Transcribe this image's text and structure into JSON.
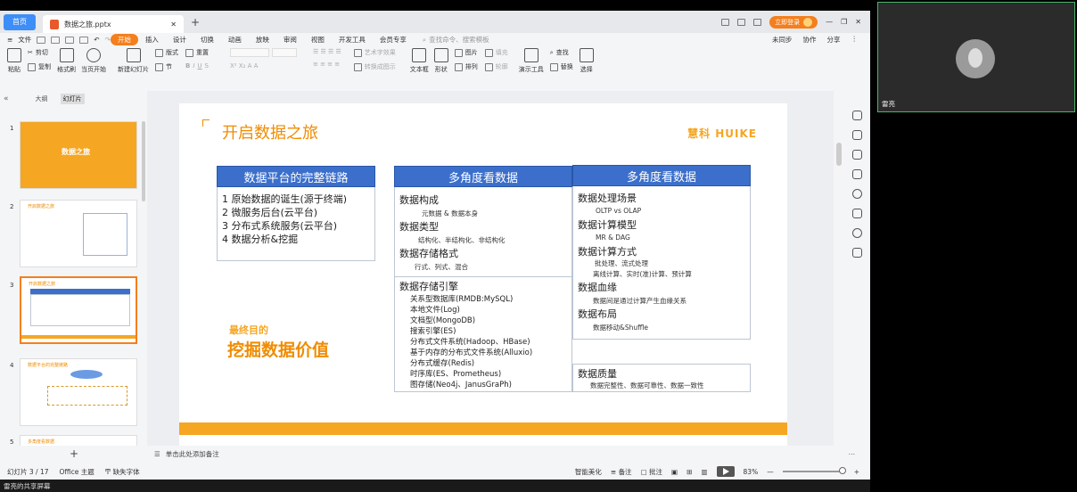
{
  "app": {
    "home_tab": "首页",
    "doc_tab": "数据之旅.pptx",
    "login_label": "立即登录",
    "menu_items": [
      "文件",
      "开始",
      "插入",
      "设计",
      "切换",
      "动画",
      "放映",
      "审阅",
      "视图",
      "开发工具",
      "会员专享"
    ],
    "active_menu": "开始",
    "search_placeholder": "查找命令、搜索模板",
    "right_actions": [
      "未同步",
      "协作",
      "分享"
    ]
  },
  "ribbon": {
    "paste": "粘贴",
    "cut": "剪切",
    "copy": "复制",
    "format_painter": "格式刷",
    "from_current": "当页开始",
    "new_slide": "新建幻灯片",
    "layout": "版式",
    "section": "节",
    "reset": "重置",
    "textbox": "文本框",
    "shapes": "形状",
    "arrange": "排列",
    "picture": "图片",
    "fill": "填充",
    "outline": "轮廓",
    "presentation_tools": "演示工具",
    "find": "查找",
    "replace": "替换",
    "select": "选择",
    "text_effect": "艺术字效果",
    "convert_smartart": "转换成图示"
  },
  "panel": {
    "outline_tab": "大纲",
    "slides_tab": "幻灯片"
  },
  "thumbnails": [
    {
      "num": "1",
      "title": "数据之旅"
    },
    {
      "num": "2",
      "title": "开启数据之旅"
    },
    {
      "num": "3",
      "title": "开启数据之旅"
    },
    {
      "num": "4",
      "title": "数据平台的完整链路"
    },
    {
      "num": "5",
      "title": "多角度看数据"
    }
  ],
  "slide": {
    "title": "开启数据之旅",
    "logo": "慧科 HUIKE",
    "col1": {
      "header": "数据平台的完整链路",
      "items": [
        "1 原始数据的诞生(源于终端)",
        "2 微服务后台(云平台)",
        "3 分布式系统服务(云平台)",
        "4 数据分析&挖掘"
      ]
    },
    "goal_small": "最终目的",
    "goal_big": "挖掘数据价值",
    "col2": {
      "header": "多角度看数据",
      "h_structure": "数据构成",
      "structure": "元数据 & 数据本身",
      "h_type": "数据类型",
      "type": "结构化、半结构化、非结构化",
      "h_format": "数据存储格式",
      "format": "行式、列式、混合",
      "h_engine": "数据存储引擎",
      "engines": [
        "关系型数据库(RMDB:MySQL)",
        "本地文件(Log)",
        "文档型(MongoDB)",
        "搜索引擎(ES)",
        "分布式文件系统(Hadoop、HBase)",
        "基于内存的分布式文件系统(Alluxio)",
        "分布式缓存(Redis)",
        "时序库(ES、Prometheus)",
        "图存储(Neo4j、JanusGraPh)"
      ]
    },
    "col3": {
      "header": "多角度看数据",
      "h_scene": "数据处理场景",
      "scene": "OLTP vs OLAP",
      "h_model": "数据计算模型",
      "model": "MR & DAG",
      "h_method": "数据计算方式",
      "method1": "批处理、流式处理",
      "method2": "离线计算、实时(准)计算、预计算",
      "h_lineage": "数据血缘",
      "lineage": "数据间是通过计算产生血缘关系",
      "h_layout": "数据布局",
      "layout": "数据移动&Shuffle",
      "h_quality": "数据质量",
      "quality": "数据完整性、数据可靠性、数据一致性"
    }
  },
  "notes_placeholder": "单击此处添加备注",
  "status": {
    "slide_count": "幻灯片 3 / 17",
    "theme": "Office 主题",
    "missing_font": "缺失字体",
    "beautify": "智能美化",
    "notes": "备注",
    "comments": "批注",
    "zoom": "83%"
  },
  "share_label": "雷亮的共享屏幕",
  "camera": {
    "name": "雷亮"
  }
}
